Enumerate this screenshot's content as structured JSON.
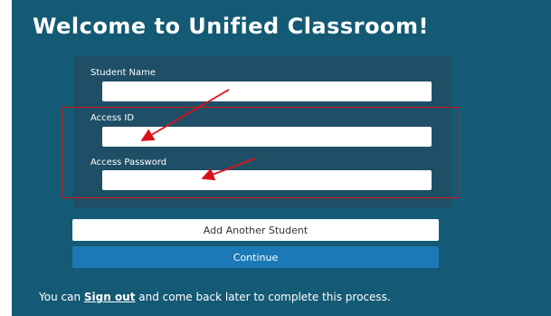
{
  "page": {
    "title": "Welcome to Unified Classroom!"
  },
  "form": {
    "student_name_label": "Student Name",
    "student_name_value": "",
    "access_id_label": "Access ID",
    "access_id_value": "",
    "access_password_label": "Access Password",
    "access_password_value": ""
  },
  "buttons": {
    "add_another_student_label": "Add Another Student",
    "continue_label": "Continue"
  },
  "footer": {
    "prefix": "You can ",
    "sign_out_link": "Sign out",
    "suffix": " and come back later to complete this process."
  },
  "colors": {
    "background": "#145a74",
    "form_card": "#1f4f67",
    "continue_button": "#1c79b7",
    "annotation_red": "#d9111a"
  }
}
